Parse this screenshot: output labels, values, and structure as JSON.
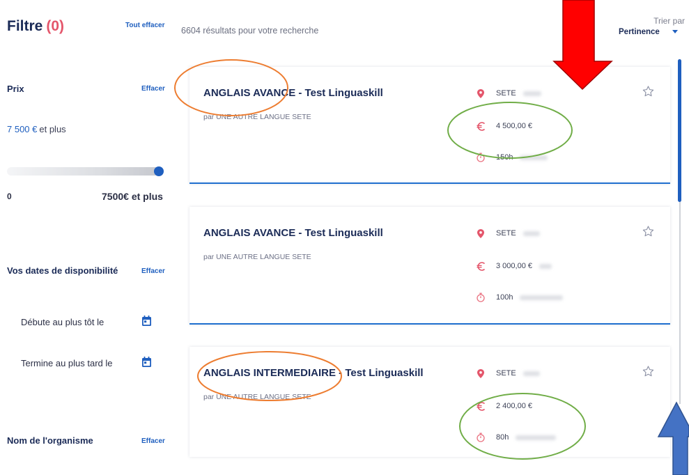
{
  "colors": {
    "navy": "#1b2b57",
    "link_blue": "#1f5fbf",
    "accent_red": "#e4566b",
    "annotation_red": "#ff0000",
    "annotation_blue": "#4472c4",
    "annotation_orange": "#ed7d31",
    "annotation_green": "#70ad47"
  },
  "sidebar": {
    "title": "Filtre",
    "count": "(0)",
    "clear_all": "Tout effacer",
    "price": {
      "heading": "Prix",
      "clear": "Effacer",
      "value_amount": "7 500 €",
      "value_suffix": "et plus",
      "slider_fraction": 1,
      "min_label": "0",
      "max_label": "7500€ et plus"
    },
    "availability": {
      "heading": "Vos dates de disponibilité",
      "clear": "Effacer",
      "start_label": "Débute au plus tôt le",
      "end_label": "Termine au plus tard le",
      "date_icon": "calendar-icon"
    },
    "organism": {
      "heading": "Nom de l'organisme",
      "clear": "Effacer"
    }
  },
  "results": {
    "summary": "6604 résultats pour votre recherche",
    "sort": {
      "label": "Trier par",
      "value": "Pertinence",
      "icon": "caret-down-icon"
    },
    "item_icons": {
      "location": "map-pin-icon",
      "price": "euro-icon",
      "duration": "stopwatch-icon",
      "favorite": "star-icon"
    },
    "items": [
      {
        "title": "ANGLAIS AVANCE - Test Linguaskill",
        "provider": "par UNE AUTRE LANGUE SETE",
        "location": "SETE",
        "price": "4 500,00 €",
        "duration": "150h"
      },
      {
        "title": "ANGLAIS AVANCE - Test Linguaskill",
        "provider": "par UNE AUTRE LANGUE SETE",
        "location": "SETE",
        "price": "3 000,00 €",
        "duration": "100h"
      },
      {
        "title": "ANGLAIS INTERMEDIAIRE - Test Linguaskill",
        "provider": "par UNE AUTRE LANGUE SETE",
        "location": "SETE",
        "price": "2 400,00 €",
        "duration": "80h"
      }
    ]
  }
}
